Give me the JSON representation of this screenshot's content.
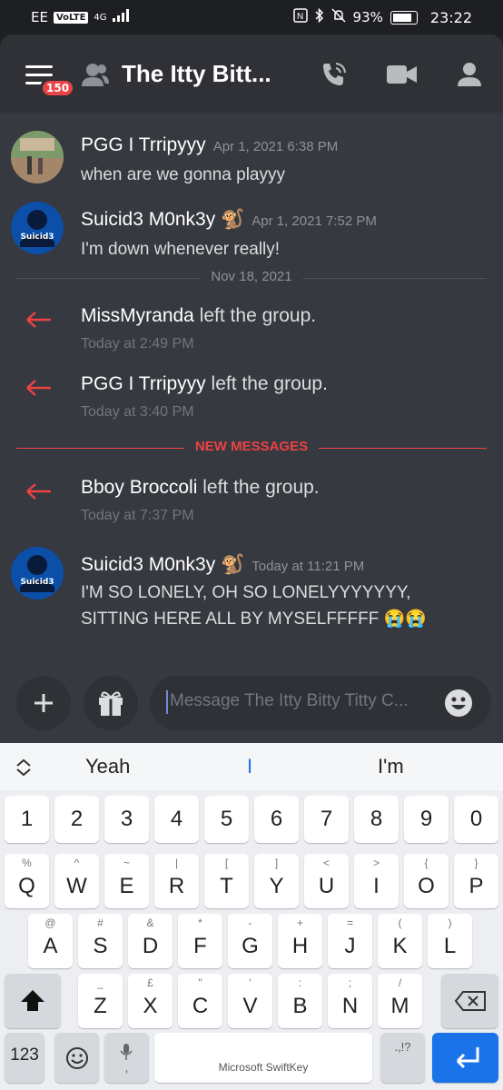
{
  "status_bar": {
    "carrier": "EE",
    "volte": "VoLTE",
    "network": "4G",
    "battery": "93%",
    "time": "23:22"
  },
  "header": {
    "unread_badge": "150",
    "title": "The Itty Bitt..."
  },
  "messages": [
    {
      "author": "PGG I Trripyyy",
      "time": "Apr 1, 2021 6:38 PM",
      "text": "when are we gonna playyy"
    },
    {
      "author": "Suicid3 M0nk3y",
      "emoji": "🐒",
      "time": "Apr 1, 2021 7:52 PM",
      "text": "I'm down whenever really!",
      "avatar_text": "Suicid3"
    },
    {
      "author": "Suicid3 M0nk3y",
      "emoji": "🐒",
      "time": "Today at 11:21 PM",
      "text_line1": "I'M SO LONELY, OH SO LONELYYYYYYY,",
      "text_line2": "SITTING HERE ALL BY MYSELFFFFF 😭😭",
      "avatar_text": "Suicid3"
    }
  ],
  "dividers": {
    "date": "Nov 18, 2021",
    "new_messages": "NEW MESSAGES"
  },
  "system_events": [
    {
      "user": "MissMyranda",
      "action": " left the group.",
      "time": "Today at 2:49 PM"
    },
    {
      "user": "PGG I Trripyyy",
      "action": " left the group.",
      "time": "Today at 3:40 PM"
    },
    {
      "user": "Bboy Broccoli",
      "action": " left the group.",
      "time": "Today at 7:37 PM"
    }
  ],
  "composer": {
    "placeholder": "Message The Itty Bitty Titty C..."
  },
  "keyboard": {
    "suggestions": [
      "Yeah",
      "I",
      "I'm"
    ],
    "number_row": [
      "1",
      "2",
      "3",
      "4",
      "5",
      "6",
      "7",
      "8",
      "9",
      "0"
    ],
    "row1": [
      {
        "m": "Q",
        "s": "%"
      },
      {
        "m": "W",
        "s": "^"
      },
      {
        "m": "E",
        "s": "~"
      },
      {
        "m": "R",
        "s": "|"
      },
      {
        "m": "T",
        "s": "["
      },
      {
        "m": "Y",
        "s": "]"
      },
      {
        "m": "U",
        "s": "<"
      },
      {
        "m": "I",
        "s": ">"
      },
      {
        "m": "O",
        "s": "{"
      },
      {
        "m": "P",
        "s": "}"
      }
    ],
    "row2": [
      {
        "m": "A",
        "s": "@"
      },
      {
        "m": "S",
        "s": "#"
      },
      {
        "m": "D",
        "s": "&"
      },
      {
        "m": "F",
        "s": "*"
      },
      {
        "m": "G",
        "s": "-"
      },
      {
        "m": "H",
        "s": "+"
      },
      {
        "m": "J",
        "s": "="
      },
      {
        "m": "K",
        "s": "("
      },
      {
        "m": "L",
        "s": ")"
      }
    ],
    "row3": [
      {
        "m": "Z",
        "s": "_"
      },
      {
        "m": "X",
        "s": "£"
      },
      {
        "m": "C",
        "s": "\""
      },
      {
        "m": "V",
        "s": "'"
      },
      {
        "m": "B",
        "s": ":"
      },
      {
        "m": "N",
        "s": ";"
      },
      {
        "m": "M",
        "s": "/"
      }
    ],
    "numbers_key": "123",
    "space_label": "Microsoft SwiftKey",
    "punct_label": ".,!?",
    "colors": {
      "accent": "#1a73e8"
    }
  }
}
